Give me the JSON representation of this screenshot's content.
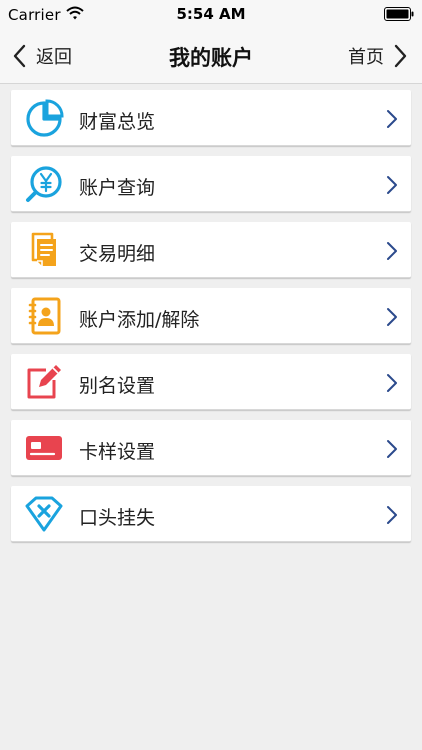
{
  "status": {
    "carrier": "Carrier",
    "time": "5:54 AM"
  },
  "nav": {
    "back_label": "返回",
    "title": "我的账户",
    "home_label": "首页"
  },
  "menu": {
    "items": [
      {
        "label": "财富总览",
        "icon": "pie-chart-icon",
        "color": "#1aa3de"
      },
      {
        "label": "账户查询",
        "icon": "yen-search-icon",
        "color": "#1aa3de"
      },
      {
        "label": "交易明细",
        "icon": "documents-icon",
        "color": "#f4a31b"
      },
      {
        "label": "账户添加/解除",
        "icon": "contact-book-icon",
        "color": "#f4a31b"
      },
      {
        "label": "别名设置",
        "icon": "edit-note-icon",
        "color": "#e8444f"
      },
      {
        "label": "卡样设置",
        "icon": "card-icon",
        "color": "#e8444f"
      },
      {
        "label": "口头挂失",
        "icon": "report-loss-icon",
        "color": "#1aa3de"
      }
    ]
  },
  "colors": {
    "chevron": "#2b4a8c",
    "background": "#efefef"
  }
}
